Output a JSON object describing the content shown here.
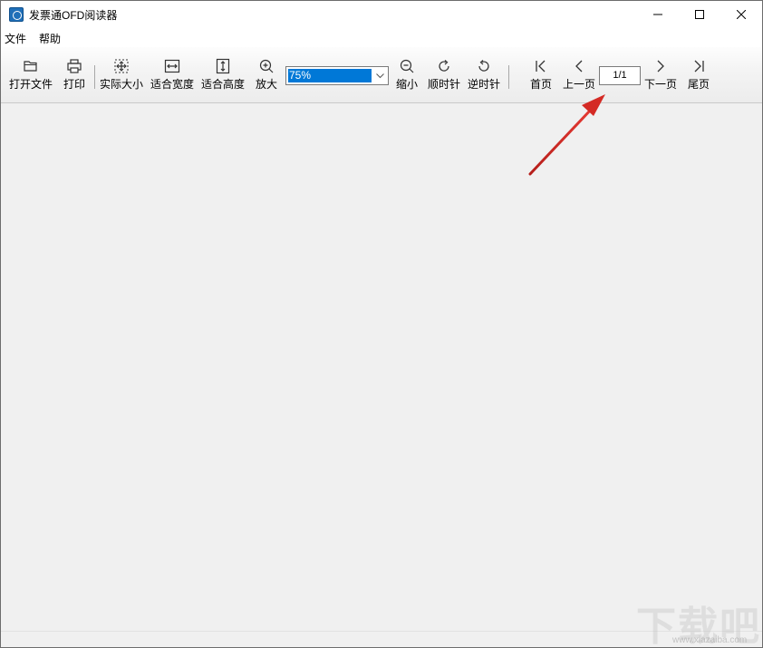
{
  "window": {
    "title": "发票通OFD阅读器",
    "minimize_icon": "minimize-icon",
    "maximize_icon": "maximize-icon",
    "close_icon": "close-icon"
  },
  "menu": {
    "items": [
      "文件",
      "帮助"
    ]
  },
  "toolbar": {
    "open_file": {
      "label": "打开文件",
      "icon": "folder-open-icon"
    },
    "print": {
      "label": "打印",
      "icon": "printer-icon"
    },
    "actual_size": {
      "label": "实际大小",
      "icon": "actual-size-icon"
    },
    "fit_width": {
      "label": "适合宽度",
      "icon": "fit-width-icon"
    },
    "fit_height": {
      "label": "适合高度",
      "icon": "fit-height-icon"
    },
    "zoom_in": {
      "label": "放大",
      "icon": "zoom-in-icon"
    },
    "zoom_select": {
      "value": "75%"
    },
    "zoom_out": {
      "label": "缩小",
      "icon": "zoom-out-icon"
    },
    "rotate_cw": {
      "label": "顺时针",
      "icon": "rotate-clockwise-icon"
    },
    "rotate_ccw": {
      "label": "逆时针",
      "icon": "rotate-counterclockwise-icon"
    },
    "first_page": {
      "label": "首页",
      "icon": "first-page-icon"
    },
    "prev_page": {
      "label": "上一页",
      "icon": "chevron-left-icon"
    },
    "page_indicator": {
      "value": "1/1"
    },
    "next_page": {
      "label": "下一页",
      "icon": "chevron-right-icon"
    },
    "last_page": {
      "label": "尾页",
      "icon": "last-page-icon"
    }
  },
  "annotation": {
    "icon": "red-arrow-icon",
    "color": "#d42a24"
  },
  "watermark": {
    "text": "下载吧",
    "url": "www.xiazaiba.com"
  },
  "colors": {
    "selection": "#0078d7",
    "background": "#f0f0f0"
  }
}
